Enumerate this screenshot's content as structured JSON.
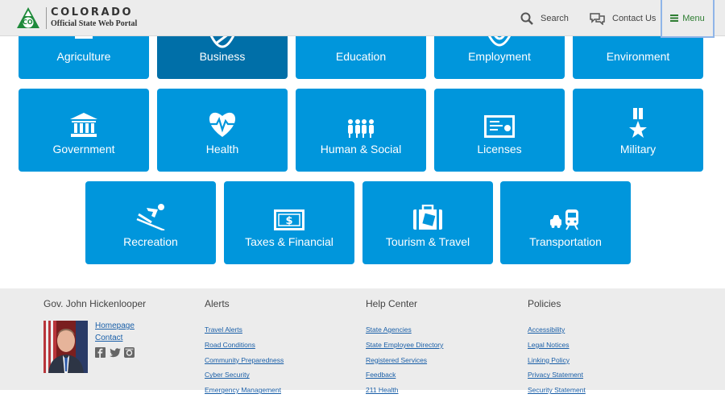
{
  "header": {
    "logo_title": "COLORADO",
    "logo_sub": "Official State Web Portal",
    "logo_badge": "CO",
    "search_label": "Search",
    "contact_label": "Contact Us",
    "menu_label": "Menu"
  },
  "tiles": {
    "agriculture": "Agriculture",
    "business": "Business",
    "education": "Education",
    "employment": "Employment",
    "environment": "Environment",
    "government": "Government",
    "health": "Health",
    "human_social": "Human & Social",
    "licenses": "Licenses",
    "military": "Military",
    "recreation": "Recreation",
    "taxes": "Taxes & Financial",
    "tourism": "Tourism & Travel",
    "transportation": "Transportation"
  },
  "footer": {
    "governor": {
      "heading": "Gov. John Hickenlooper",
      "links": [
        "Homepage",
        "Contact"
      ]
    },
    "alerts": {
      "heading": "Alerts",
      "links": [
        "Travel Alerts",
        "Road Conditions",
        "Community Preparedness",
        "Cyber Security",
        "Emergency Management"
      ]
    },
    "help": {
      "heading": "Help Center",
      "links": [
        "State Agencies",
        "State Employee Directory",
        "Registered Services",
        "Feedback",
        "211 Health"
      ]
    },
    "policies": {
      "heading": "Policies",
      "links": [
        "Accessibility",
        "Legal Notices",
        "Linking Policy",
        "Privacy Statement",
        "Security Statement"
      ]
    }
  },
  "colors": {
    "tile": "#0096dc",
    "tile_active": "#006fa8",
    "logo_green": "#1e8a3a",
    "link": "#1a5fa8"
  }
}
